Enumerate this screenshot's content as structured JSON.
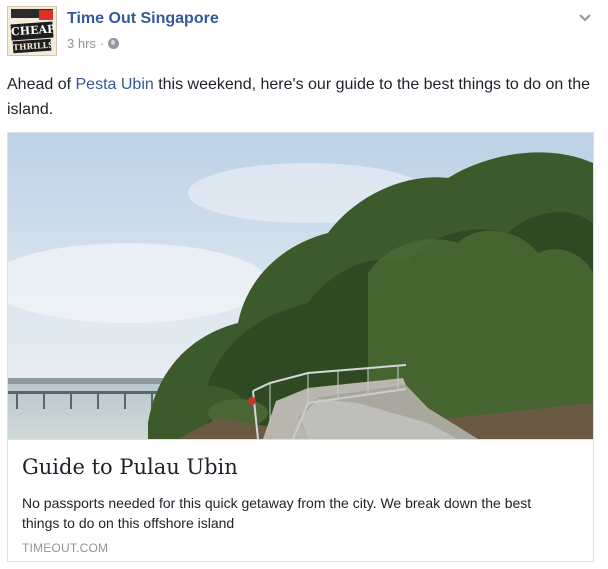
{
  "header": {
    "page_name": "Time Out Singapore",
    "timestamp": "3 hrs",
    "separator": "·",
    "avatar": {
      "line1": "CHEAP",
      "line2": "THRILLS"
    },
    "icons": {
      "privacy": "globe-icon",
      "options": "chevron-down-icon"
    }
  },
  "post": {
    "text_before": "Ahead of ",
    "link_text": "Pesta Ubin",
    "text_after": " this weekend, here's our guide to the best things to do on the island."
  },
  "link_card": {
    "title": "Guide to Pulau Ubin",
    "description": "No passports needed for this quick getaway from the city. We break down the best things to do on this offshore island",
    "domain": "TIMEOUT.COM"
  },
  "colors": {
    "link_blue": "#365899",
    "text": "#1d2129",
    "muted": "#90949c",
    "border": "#dddfe2"
  }
}
